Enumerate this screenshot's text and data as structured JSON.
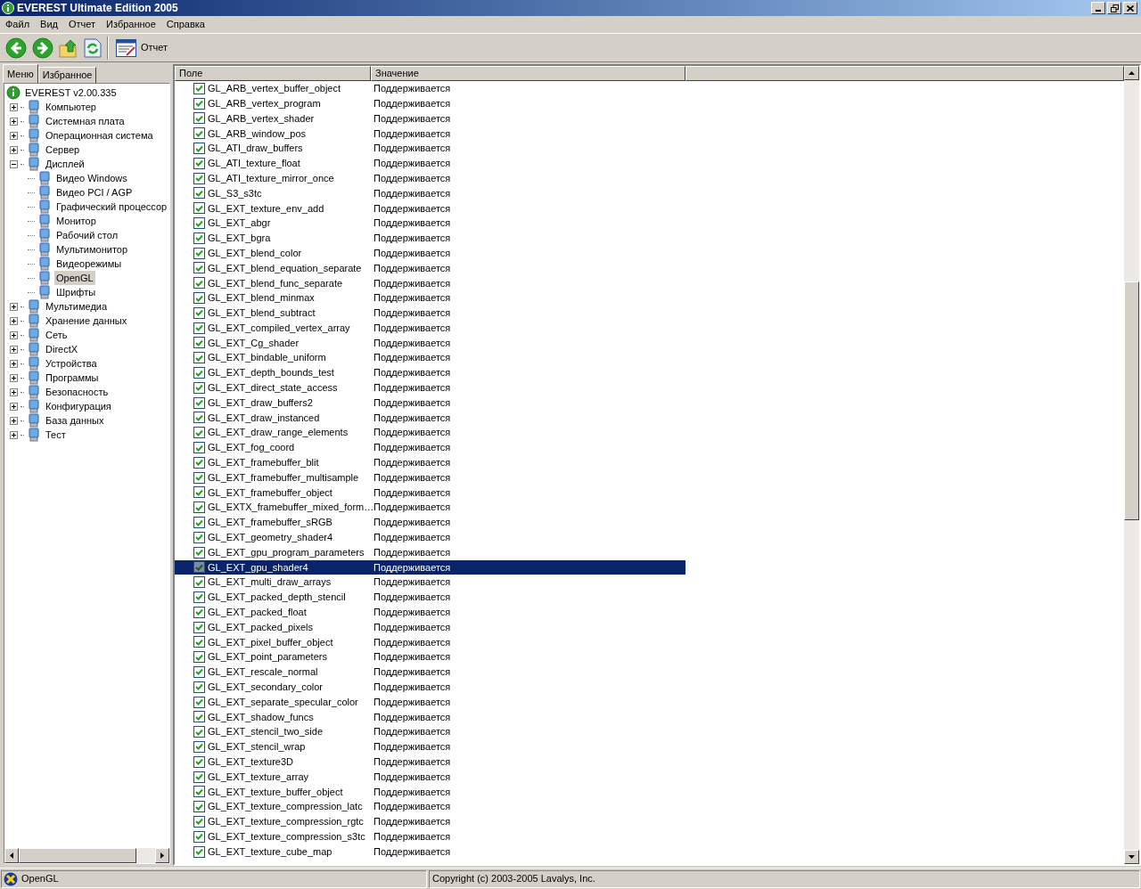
{
  "window": {
    "title": "EVEREST Ultimate Edition 2005"
  },
  "menu": [
    "Файл",
    "Вид",
    "Отчет",
    "Избранное",
    "Справка"
  ],
  "toolbar": {
    "report_button": "Отчет"
  },
  "tabs": [
    {
      "label": "Меню",
      "selected": true
    },
    {
      "label": "Избранное",
      "selected": false
    }
  ],
  "tree": {
    "label": "EVEREST v2.00.335",
    "selected": false,
    "children": [
      {
        "label": "Компьютер",
        "expanded": false,
        "selected": false
      },
      {
        "label": "Системная плата",
        "expanded": false,
        "selected": false
      },
      {
        "label": "Операционная система",
        "expanded": false,
        "selected": false
      },
      {
        "label": "Сервер",
        "expanded": false,
        "selected": false
      },
      {
        "label": "Дисплей",
        "expanded": true,
        "selected": false,
        "children": [
          {
            "label": "Видео Windows",
            "selected": false
          },
          {
            "label": "Видео PCI / AGP",
            "selected": false
          },
          {
            "label": "Графический процессор",
            "selected": false
          },
          {
            "label": "Монитор",
            "selected": false
          },
          {
            "label": "Рабочий стол",
            "selected": false
          },
          {
            "label": "Мультимонитор",
            "selected": false
          },
          {
            "label": "Видеорежимы",
            "selected": false
          },
          {
            "label": "OpenGL",
            "selected": true
          },
          {
            "label": "Шрифты",
            "selected": false
          }
        ]
      },
      {
        "label": "Мультимедиа",
        "expanded": false,
        "selected": false
      },
      {
        "label": "Хранение данных",
        "expanded": false,
        "selected": false
      },
      {
        "label": "Сеть",
        "expanded": false,
        "selected": false
      },
      {
        "label": "DirectX",
        "expanded": false,
        "selected": false
      },
      {
        "label": "Устройства",
        "expanded": false,
        "selected": false
      },
      {
        "label": "Программы",
        "expanded": false,
        "selected": false
      },
      {
        "label": "Безопасность",
        "expanded": false,
        "selected": false
      },
      {
        "label": "Конфигурация",
        "expanded": false,
        "selected": false
      },
      {
        "label": "База данных",
        "expanded": false,
        "selected": false
      },
      {
        "label": "Тест",
        "expanded": false,
        "selected": false
      }
    ]
  },
  "table": {
    "columns": [
      "Поле",
      "Значение"
    ],
    "rows": [
      {
        "field": "GL_ARB_vertex_buffer_object",
        "value": "Поддерживается",
        "checked": true,
        "selected": false
      },
      {
        "field": "GL_ARB_vertex_program",
        "value": "Поддерживается",
        "checked": true,
        "selected": false
      },
      {
        "field": "GL_ARB_vertex_shader",
        "value": "Поддерживается",
        "checked": true,
        "selected": false
      },
      {
        "field": "GL_ARB_window_pos",
        "value": "Поддерживается",
        "checked": true,
        "selected": false
      },
      {
        "field": "GL_ATI_draw_buffers",
        "value": "Поддерживается",
        "checked": true,
        "selected": false
      },
      {
        "field": "GL_ATI_texture_float",
        "value": "Поддерживается",
        "checked": true,
        "selected": false
      },
      {
        "field": "GL_ATI_texture_mirror_once",
        "value": "Поддерживается",
        "checked": true,
        "selected": false
      },
      {
        "field": "GL_S3_s3tc",
        "value": "Поддерживается",
        "checked": true,
        "selected": false
      },
      {
        "field": "GL_EXT_texture_env_add",
        "value": "Поддерживается",
        "checked": true,
        "selected": false
      },
      {
        "field": "GL_EXT_abgr",
        "value": "Поддерживается",
        "checked": true,
        "selected": false
      },
      {
        "field": "GL_EXT_bgra",
        "value": "Поддерживается",
        "checked": true,
        "selected": false
      },
      {
        "field": "GL_EXT_blend_color",
        "value": "Поддерживается",
        "checked": true,
        "selected": false
      },
      {
        "field": "GL_EXT_blend_equation_separate",
        "value": "Поддерживается",
        "checked": true,
        "selected": false
      },
      {
        "field": "GL_EXT_blend_func_separate",
        "value": "Поддерживается",
        "checked": true,
        "selected": false
      },
      {
        "field": "GL_EXT_blend_minmax",
        "value": "Поддерживается",
        "checked": true,
        "selected": false
      },
      {
        "field": "GL_EXT_blend_subtract",
        "value": "Поддерживается",
        "checked": true,
        "selected": false
      },
      {
        "field": "GL_EXT_compiled_vertex_array",
        "value": "Поддерживается",
        "checked": true,
        "selected": false
      },
      {
        "field": "GL_EXT_Cg_shader",
        "value": "Поддерживается",
        "checked": true,
        "selected": false
      },
      {
        "field": "GL_EXT_bindable_uniform",
        "value": "Поддерживается",
        "checked": true,
        "selected": false
      },
      {
        "field": "GL_EXT_depth_bounds_test",
        "value": "Поддерживается",
        "checked": true,
        "selected": false
      },
      {
        "field": "GL_EXT_direct_state_access",
        "value": "Поддерживается",
        "checked": true,
        "selected": false
      },
      {
        "field": "GL_EXT_draw_buffers2",
        "value": "Поддерживается",
        "checked": true,
        "selected": false
      },
      {
        "field": "GL_EXT_draw_instanced",
        "value": "Поддерживается",
        "checked": true,
        "selected": false
      },
      {
        "field": "GL_EXT_draw_range_elements",
        "value": "Поддерживается",
        "checked": true,
        "selected": false
      },
      {
        "field": "GL_EXT_fog_coord",
        "value": "Поддерживается",
        "checked": true,
        "selected": false
      },
      {
        "field": "GL_EXT_framebuffer_blit",
        "value": "Поддерживается",
        "checked": true,
        "selected": false
      },
      {
        "field": "GL_EXT_framebuffer_multisample",
        "value": "Поддерживается",
        "checked": true,
        "selected": false
      },
      {
        "field": "GL_EXT_framebuffer_object",
        "value": "Поддерживается",
        "checked": true,
        "selected": false
      },
      {
        "field": "GL_EXTX_framebuffer_mixed_form…",
        "value": "Поддерживается",
        "checked": true,
        "selected": false
      },
      {
        "field": "GL_EXT_framebuffer_sRGB",
        "value": "Поддерживается",
        "checked": true,
        "selected": false
      },
      {
        "field": "GL_EXT_geometry_shader4",
        "value": "Поддерживается",
        "checked": true,
        "selected": false
      },
      {
        "field": "GL_EXT_gpu_program_parameters",
        "value": "Поддерживается",
        "checked": true,
        "selected": false
      },
      {
        "field": "GL_EXT_gpu_shader4",
        "value": "Поддерживается",
        "checked": true,
        "selected": true
      },
      {
        "field": "GL_EXT_multi_draw_arrays",
        "value": "Поддерживается",
        "checked": true,
        "selected": false
      },
      {
        "field": "GL_EXT_packed_depth_stencil",
        "value": "Поддерживается",
        "checked": true,
        "selected": false
      },
      {
        "field": "GL_EXT_packed_float",
        "value": "Поддерживается",
        "checked": true,
        "selected": false
      },
      {
        "field": "GL_EXT_packed_pixels",
        "value": "Поддерживается",
        "checked": true,
        "selected": false
      },
      {
        "field": "GL_EXT_pixel_buffer_object",
        "value": "Поддерживается",
        "checked": true,
        "selected": false
      },
      {
        "field": "GL_EXT_point_parameters",
        "value": "Поддерживается",
        "checked": true,
        "selected": false
      },
      {
        "field": "GL_EXT_rescale_normal",
        "value": "Поддерживается",
        "checked": true,
        "selected": false
      },
      {
        "field": "GL_EXT_secondary_color",
        "value": "Поддерживается",
        "checked": true,
        "selected": false
      },
      {
        "field": "GL_EXT_separate_specular_color",
        "value": "Поддерживается",
        "checked": true,
        "selected": false
      },
      {
        "field": "GL_EXT_shadow_funcs",
        "value": "Поддерживается",
        "checked": true,
        "selected": false
      },
      {
        "field": "GL_EXT_stencil_two_side",
        "value": "Поддерживается",
        "checked": true,
        "selected": false
      },
      {
        "field": "GL_EXT_stencil_wrap",
        "value": "Поддерживается",
        "checked": true,
        "selected": false
      },
      {
        "field": "GL_EXT_texture3D",
        "value": "Поддерживается",
        "checked": true,
        "selected": false
      },
      {
        "field": "GL_EXT_texture_array",
        "value": "Поддерживается",
        "checked": true,
        "selected": false
      },
      {
        "field": "GL_EXT_texture_buffer_object",
        "value": "Поддерживается",
        "checked": true,
        "selected": false
      },
      {
        "field": "GL_EXT_texture_compression_latc",
        "value": "Поддерживается",
        "checked": true,
        "selected": false
      },
      {
        "field": "GL_EXT_texture_compression_rgtc",
        "value": "Поддерживается",
        "checked": true,
        "selected": false
      },
      {
        "field": "GL_EXT_texture_compression_s3tc",
        "value": "Поддерживается",
        "checked": true,
        "selected": false
      },
      {
        "field": "GL_EXT_texture_cube_map",
        "value": "Поддерживается",
        "checked": true,
        "selected": false
      }
    ]
  },
  "status_bar": {
    "item": "OpenGL",
    "copyright": "Copyright (c) 2003-2005 Lavalys, Inc."
  }
}
